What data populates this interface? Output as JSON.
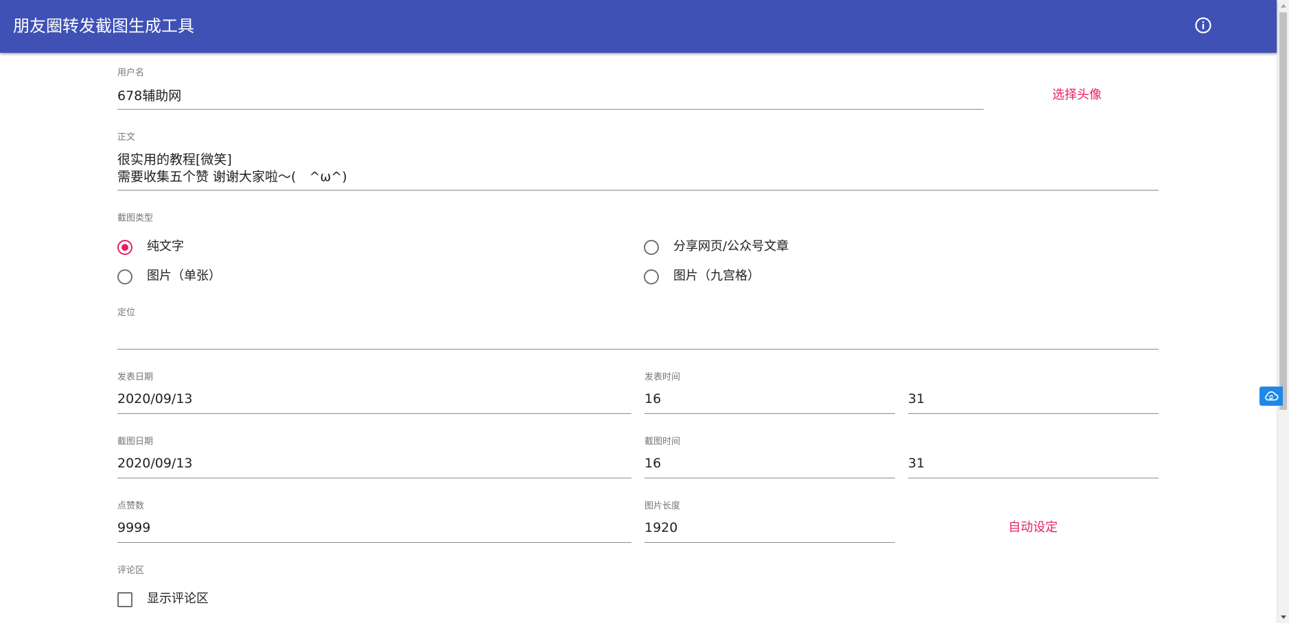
{
  "app": {
    "title": "朋友圈转发截图生成工具",
    "info_icon": "info-circle-icon"
  },
  "form": {
    "username": {
      "label": "用户名",
      "value": "678辅助网"
    },
    "choose_avatar_label": "选择头像",
    "body": {
      "label": "正文",
      "value": "很实用的教程[微笑]\n需要收集五个赞 谢谢大家啦～(　^ω^)"
    },
    "screenshot_type": {
      "label": "截图类型",
      "options": [
        {
          "label": "纯文字",
          "checked": true
        },
        {
          "label": "分享网页/公众号文章",
          "checked": false
        },
        {
          "label": "图片（单张）",
          "checked": false
        },
        {
          "label": "图片（九宫格）",
          "checked": false
        }
      ]
    },
    "location": {
      "label": "定位",
      "value": ""
    },
    "publish_date": {
      "label": "发表日期",
      "value": "2020/09/13"
    },
    "publish_time": {
      "label": "发表时间",
      "hour": "16",
      "minute": "31"
    },
    "screenshot_date": {
      "label": "截图日期",
      "value": "2020/09/13"
    },
    "screenshot_time": {
      "label": "截图时间",
      "hour": "16",
      "minute": "31"
    },
    "likes": {
      "label": "点赞数",
      "value": "9999"
    },
    "image_length": {
      "label": "图片长度",
      "value": "1920"
    },
    "auto_set_label": "自动设定",
    "comments": {
      "label": "评论区",
      "checkbox_label": "显示评论区",
      "checked": false
    }
  },
  "floating": {
    "cloud_icon": "cloud-sync-icon"
  },
  "colors": {
    "primary": "#3f51b5",
    "accent": "#e91e63",
    "floating": "#1e88e5"
  }
}
